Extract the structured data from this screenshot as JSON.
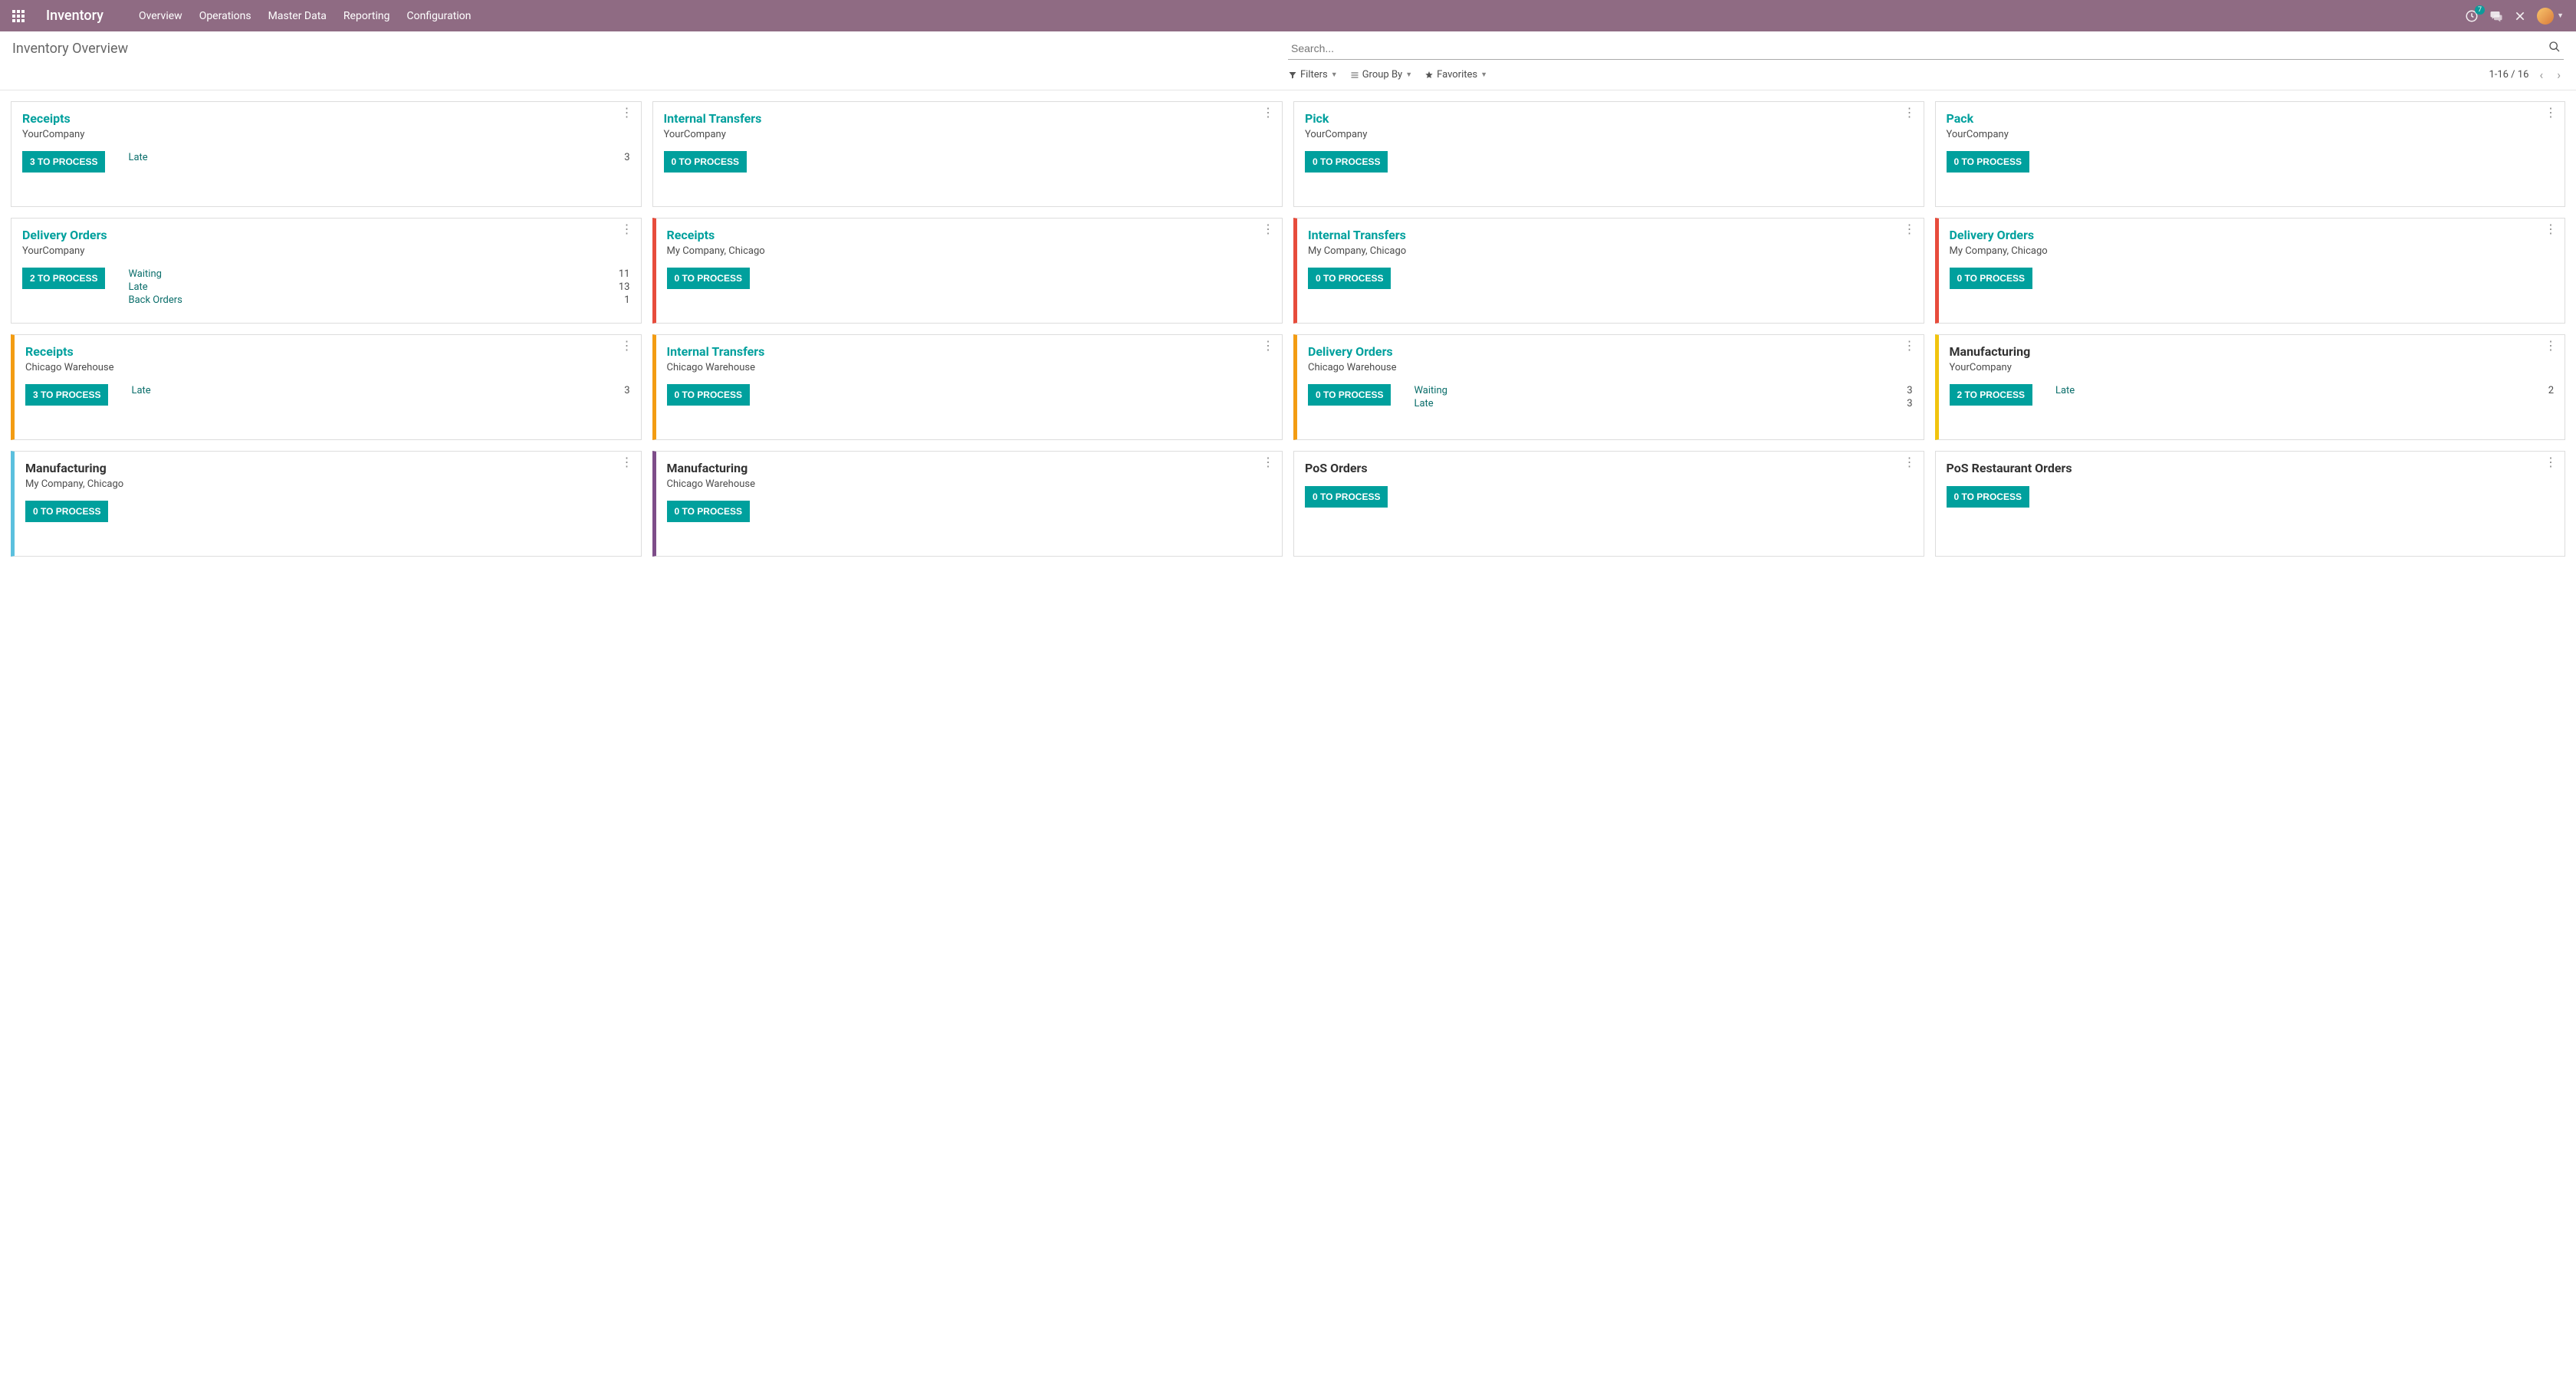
{
  "header": {
    "app_title": "Inventory",
    "menu": [
      "Overview",
      "Operations",
      "Master Data",
      "Reporting",
      "Configuration"
    ],
    "notif_badge": "7"
  },
  "control": {
    "page_title": "Inventory Overview",
    "search_placeholder": "Search...",
    "filters_label": "Filters",
    "groupby_label": "Group By",
    "favorites_label": "Favorites",
    "pager": "1-16 / 16"
  },
  "cards": [
    {
      "title": "Receipts",
      "company": "YourCompany",
      "button": "3 TO PROCESS",
      "accent": "none",
      "title_color": "teal",
      "stats": [
        {
          "label": "Late",
          "count": "3"
        }
      ]
    },
    {
      "title": "Internal Transfers",
      "company": "YourCompany",
      "button": "0 TO PROCESS",
      "accent": "none",
      "title_color": "teal",
      "stats": []
    },
    {
      "title": "Pick",
      "company": "YourCompany",
      "button": "0 TO PROCESS",
      "accent": "none",
      "title_color": "teal",
      "stats": []
    },
    {
      "title": "Pack",
      "company": "YourCompany",
      "button": "0 TO PROCESS",
      "accent": "none",
      "title_color": "teal",
      "stats": []
    },
    {
      "title": "Delivery Orders",
      "company": "YourCompany",
      "button": "2 TO PROCESS",
      "accent": "none",
      "title_color": "teal",
      "stats": [
        {
          "label": "Waiting",
          "count": "11"
        },
        {
          "label": "Late",
          "count": "13"
        },
        {
          "label": "Back Orders",
          "count": "1"
        }
      ]
    },
    {
      "title": "Receipts",
      "company": "My Company, Chicago",
      "button": "0 TO PROCESS",
      "accent": "red",
      "title_color": "teal",
      "stats": []
    },
    {
      "title": "Internal Transfers",
      "company": "My Company, Chicago",
      "button": "0 TO PROCESS",
      "accent": "red",
      "title_color": "teal",
      "stats": []
    },
    {
      "title": "Delivery Orders",
      "company": "My Company, Chicago",
      "button": "0 TO PROCESS",
      "accent": "red",
      "title_color": "teal",
      "stats": []
    },
    {
      "title": "Receipts",
      "company": "Chicago Warehouse",
      "button": "3 TO PROCESS",
      "accent": "orange",
      "title_color": "teal",
      "stats": [
        {
          "label": "Late",
          "count": "3"
        }
      ]
    },
    {
      "title": "Internal Transfers",
      "company": "Chicago Warehouse",
      "button": "0 TO PROCESS",
      "accent": "orange",
      "title_color": "teal",
      "stats": []
    },
    {
      "title": "Delivery Orders",
      "company": "Chicago Warehouse",
      "button": "0 TO PROCESS",
      "accent": "orange",
      "title_color": "teal",
      "stats": [
        {
          "label": "Waiting",
          "count": "3"
        },
        {
          "label": "Late",
          "count": "3"
        }
      ]
    },
    {
      "title": "Manufacturing",
      "company": "YourCompany",
      "button": "2 TO PROCESS",
      "accent": "yellow",
      "title_color": "black",
      "stats": [
        {
          "label": "Late",
          "count": "2"
        }
      ]
    },
    {
      "title": "Manufacturing",
      "company": "My Company, Chicago",
      "button": "0 TO PROCESS",
      "accent": "blue",
      "title_color": "black",
      "stats": []
    },
    {
      "title": "Manufacturing",
      "company": "Chicago Warehouse",
      "button": "0 TO PROCESS",
      "accent": "purple",
      "title_color": "black",
      "stats": []
    },
    {
      "title": "PoS Orders",
      "company": "",
      "button": "0 TO PROCESS",
      "accent": "none",
      "title_color": "black",
      "stats": []
    },
    {
      "title": "PoS Restaurant Orders",
      "company": "",
      "button": "0 TO PROCESS",
      "accent": "none",
      "title_color": "black",
      "stats": []
    }
  ]
}
